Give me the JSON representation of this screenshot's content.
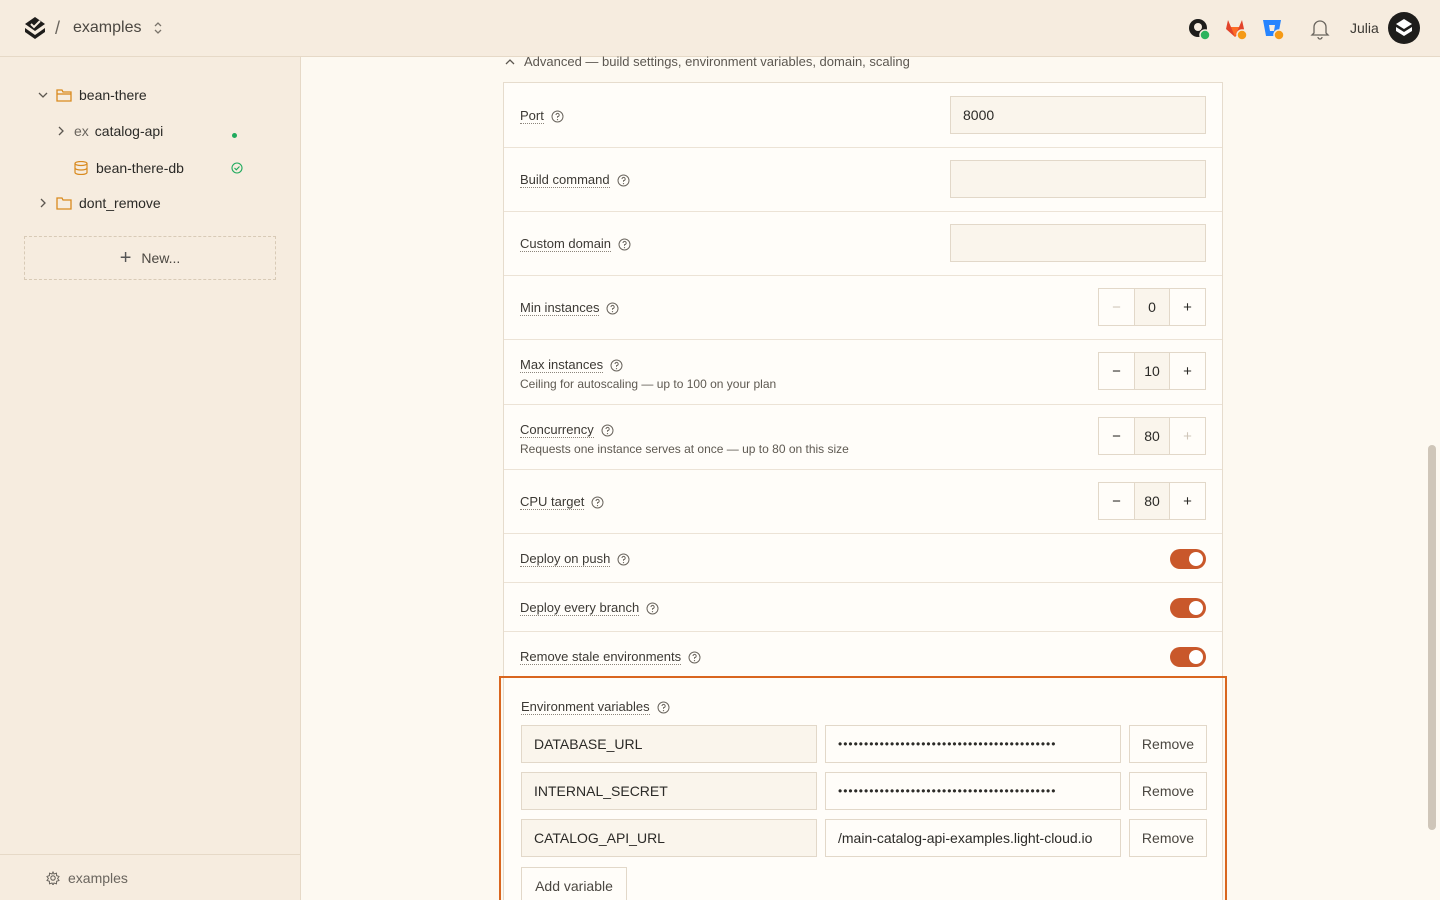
{
  "header": {
    "separator": "/",
    "project": "examples",
    "user": "Julia"
  },
  "sidebar": {
    "tree": [
      {
        "label": "bean-there"
      },
      {
        "prefix": "ex",
        "label": "catalog-api"
      },
      {
        "label": "bean-there-db"
      },
      {
        "label": "dont_remove"
      }
    ],
    "new_label": "New...",
    "footer_label": "examples"
  },
  "advanced": {
    "header": "Advanced — build settings, environment variables, domain, scaling",
    "port": {
      "label": "Port",
      "value": "8000"
    },
    "build_command": {
      "label": "Build command",
      "value": ""
    },
    "custom_domain": {
      "label": "Custom domain",
      "value": ""
    },
    "min_instances": {
      "label": "Min instances",
      "value": "0",
      "minus": "−",
      "plus": "+"
    },
    "max_instances": {
      "label": "Max instances",
      "sub": "Ceiling for autoscaling — up to 100 on your plan",
      "value": "10",
      "minus": "−",
      "plus": "+"
    },
    "concurrency": {
      "label": "Concurrency",
      "sub": "Requests one instance serves at once — up to 80 on this size",
      "value": "80",
      "minus": "−",
      "plus": "+"
    },
    "cpu_target": {
      "label": "CPU target",
      "value": "80",
      "minus": "−",
      "plus": "+"
    },
    "deploy_on_push": {
      "label": "Deploy on push",
      "on": true
    },
    "deploy_every_branch": {
      "label": "Deploy every branch",
      "on": true
    },
    "remove_stale": {
      "label": "Remove stale environments",
      "on": true
    }
  },
  "env": {
    "label": "Environment variables",
    "rows": [
      {
        "key": "DATABASE_URL",
        "value": "••••••••••••••••••••••••••••••••••••••••••",
        "remove": "Remove"
      },
      {
        "key": "INTERNAL_SECRET",
        "value": "••••••••••••••••••••••••••••••••••••••••••",
        "remove": "Remove"
      },
      {
        "key": "CATALOG_API_URL",
        "value": "/main-catalog-api-examples.light-cloud.io",
        "remove": "Remove"
      }
    ],
    "add_label": "Add variable"
  },
  "colors": {
    "accent": "#c9582b",
    "highlight": "#d9661f",
    "status_green": "#1faa5d"
  }
}
